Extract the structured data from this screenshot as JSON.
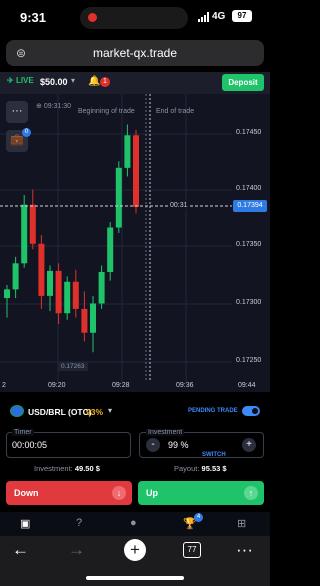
{
  "status": {
    "time": "9:31",
    "network": "4G",
    "battery": "97"
  },
  "browser": {
    "url": "market-qx.trade",
    "tab_count": "77"
  },
  "topbar": {
    "live": "LIVE",
    "balance": "$50.00",
    "notif_count": "1",
    "deposit": "Deposit"
  },
  "chart": {
    "time_label": "09:31:30",
    "begin_label": "Beginning of trade",
    "end_label": "End of trade",
    "countdown": "00:31",
    "current_price": "0.17394",
    "low_label": "0.17263",
    "price_ticks": [
      "0.17450",
      "0.17400",
      "0.17350",
      "0.17300",
      "0.17250"
    ],
    "time_ticks": [
      "2",
      "09:20",
      "09:28",
      "09:36",
      "09:44"
    ],
    "colors": {
      "up": "#1fc36a",
      "down": "#e0302c"
    },
    "candles": [
      {
        "o": 0.1731,
        "h": 0.17322,
        "l": 0.17292,
        "c": 0.17318
      },
      {
        "o": 0.17318,
        "h": 0.17348,
        "l": 0.1731,
        "c": 0.17342
      },
      {
        "o": 0.17342,
        "h": 0.17405,
        "l": 0.17338,
        "c": 0.17396
      },
      {
        "o": 0.17396,
        "h": 0.1741,
        "l": 0.17355,
        "c": 0.1736
      },
      {
        "o": 0.1736,
        "h": 0.17368,
        "l": 0.173,
        "c": 0.17312
      },
      {
        "o": 0.17312,
        "h": 0.1734,
        "l": 0.17298,
        "c": 0.17335
      },
      {
        "o": 0.17335,
        "h": 0.17342,
        "l": 0.17286,
        "c": 0.17296
      },
      {
        "o": 0.17296,
        "h": 0.1733,
        "l": 0.1729,
        "c": 0.17325
      },
      {
        "o": 0.17325,
        "h": 0.17336,
        "l": 0.17292,
        "c": 0.173
      },
      {
        "o": 0.173,
        "h": 0.17316,
        "l": 0.1727,
        "c": 0.17278
      },
      {
        "o": 0.17278,
        "h": 0.17312,
        "l": 0.1726,
        "c": 0.17305
      },
      {
        "o": 0.17305,
        "h": 0.1734,
        "l": 0.173,
        "c": 0.17334
      },
      {
        "o": 0.17334,
        "h": 0.1738,
        "l": 0.17326,
        "c": 0.17375
      },
      {
        "o": 0.17375,
        "h": 0.17436,
        "l": 0.1737,
        "c": 0.1743
      },
      {
        "o": 0.1743,
        "h": 0.1747,
        "l": 0.17422,
        "c": 0.1746
      },
      {
        "o": 0.1746,
        "h": 0.17465,
        "l": 0.17388,
        "c": 0.17394
      }
    ]
  },
  "instrument": {
    "pair": "USD/BRL (OTC)",
    "payout_pct": "93%",
    "pending": "PENDING TRADE"
  },
  "timer": {
    "label": "Timer",
    "value": "00:00:05"
  },
  "investment": {
    "label": "Investment",
    "value": "99 %",
    "switch": "SWITCH",
    "minus": "-",
    "plus": "+"
  },
  "summary": {
    "investment_label": "Investment:",
    "investment_value": "49.50 $",
    "payout_label": "Payout:",
    "payout_value": "95.53 $"
  },
  "trade": {
    "down": "Down",
    "up": "Up"
  },
  "appnav": {
    "trophy_badge": "4"
  }
}
